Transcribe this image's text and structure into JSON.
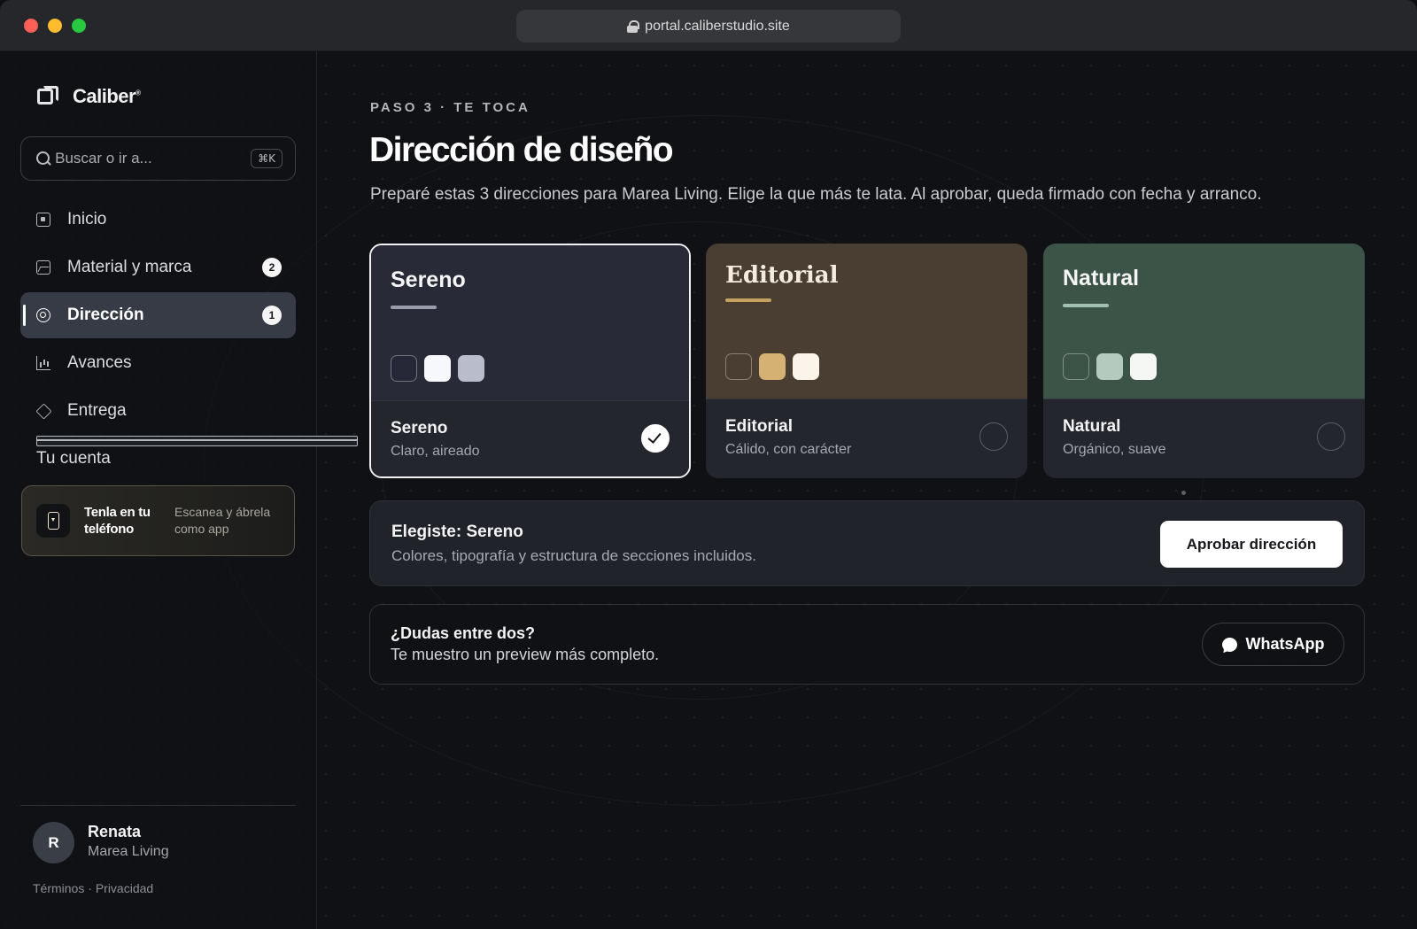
{
  "browser": {
    "url": "portal.caliberstudio.site"
  },
  "sidebar": {
    "brand": "Caliber",
    "brand_mark": "®",
    "search": {
      "placeholder": "Buscar o ir a...",
      "shortcut": "⌘K"
    },
    "items": [
      {
        "label": "Inicio",
        "icon": "home-icon"
      },
      {
        "label": "Material y marca",
        "icon": "image-icon",
        "badge": "2"
      },
      {
        "label": "Dirección",
        "icon": "target-icon",
        "badge": "1",
        "active": true
      },
      {
        "label": "Avances",
        "icon": "chart-icon"
      },
      {
        "label": "Entrega",
        "icon": "box-icon"
      },
      {
        "label": "Tu cuenta",
        "icon": "card-icon"
      }
    ],
    "phone_card": {
      "title": "Tenla en tu teléfono",
      "subtitle": "Escanea y ábrela como app"
    },
    "user": {
      "initial": "R",
      "name": "Renata",
      "org": "Marea Living"
    },
    "legal": {
      "terms": "Términos",
      "separator": " · ",
      "privacy": "Privacidad"
    }
  },
  "main": {
    "eyebrow": "PASO 3 · TE TOCA",
    "title": "Dirección de diseño",
    "description": "Preparé estas 3 direcciones para Marea Living. Elige la que más te lata. Al aprobar, queda firmado con fecha y arranco.",
    "options": [
      {
        "head_title": "Sereno",
        "name": "Sereno",
        "subtitle": "Claro, aireado",
        "selected": true,
        "swatches": [
          "#262837",
          "#f7f8fb",
          "#b8bccb"
        ]
      },
      {
        "head_title": "Editorial",
        "name": "Editorial",
        "subtitle": "Cálido, con carácter",
        "selected": false,
        "swatches": [
          "#4a3d31",
          "#d5b173",
          "#faf4ea"
        ]
      },
      {
        "head_title": "Natural",
        "name": "Natural",
        "subtitle": "Orgánico, suave",
        "selected": false,
        "swatches": [
          "#3c5447",
          "#b5cabe",
          "#f4f7f4"
        ]
      }
    ],
    "choice": {
      "title": "Elegiste: Sereno",
      "subtitle": "Colores, tipografía y estructura de secciones incluidos.",
      "approve_label": "Aprobar dirección"
    },
    "doubts": {
      "title": "¿Dudas entre dos?",
      "subtitle": "Te muestro un preview más completo.",
      "button_label": "WhatsApp",
      "button_icon": "chat-icon"
    }
  }
}
